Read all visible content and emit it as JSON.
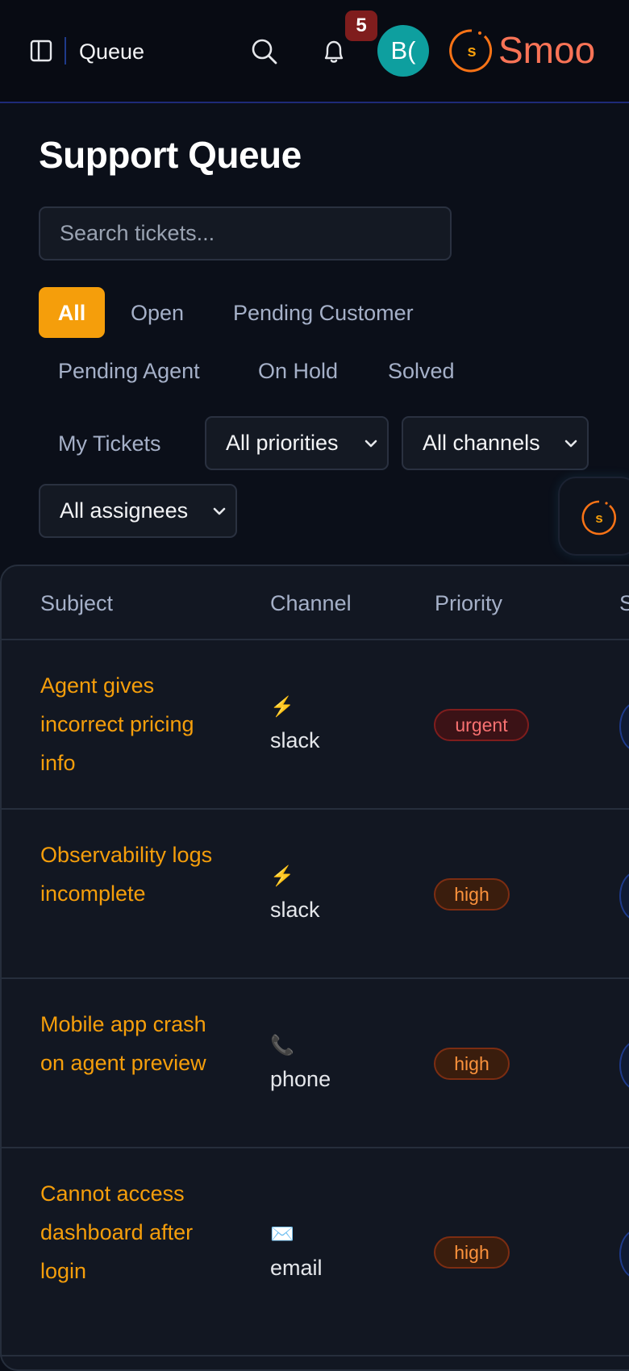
{
  "topbar": {
    "title": "Queue",
    "notification_count": "5",
    "avatar_initials": "B(",
    "logo_mark_letter": "s",
    "logo_text": "Smoo"
  },
  "page": {
    "title": "Support Queue",
    "search_placeholder": "Search tickets..."
  },
  "tabs": [
    {
      "label": "All",
      "active": true
    },
    {
      "label": "Open"
    },
    {
      "label": "Pending Customer"
    },
    {
      "label": "Pending Agent"
    },
    {
      "label": "On Hold"
    },
    {
      "label": "Solved"
    },
    {
      "label": "My Tickets"
    }
  ],
  "filters": {
    "priority": "All priorities",
    "channel": "All channels",
    "assignee": "All assignees"
  },
  "float_button": {
    "letter": "s"
  },
  "table": {
    "headers": {
      "subject": "Subject",
      "channel": "Channel",
      "priority": "Priority",
      "status": "S"
    },
    "rows": [
      {
        "subject": "Agent gives incorrect pricing info",
        "channel_icon": "⚡",
        "channel": "slack",
        "priority": "urgent"
      },
      {
        "subject": "Observability logs incomplete",
        "channel_icon": "⚡",
        "channel": "slack",
        "priority": "high"
      },
      {
        "subject": "Mobile app crash on agent preview",
        "channel_icon": "📞",
        "channel": "phone",
        "priority": "high"
      },
      {
        "subject": "Cannot access dashboard after login",
        "channel_icon": "✉️",
        "channel": "email",
        "priority": "high"
      }
    ]
  },
  "colors": {
    "accent": "#f59e0b",
    "background": "#0b0f19",
    "urgent": "#f87171",
    "high": "#fb923c",
    "avatar": "#0e9f9f",
    "logo": "#f97356"
  }
}
